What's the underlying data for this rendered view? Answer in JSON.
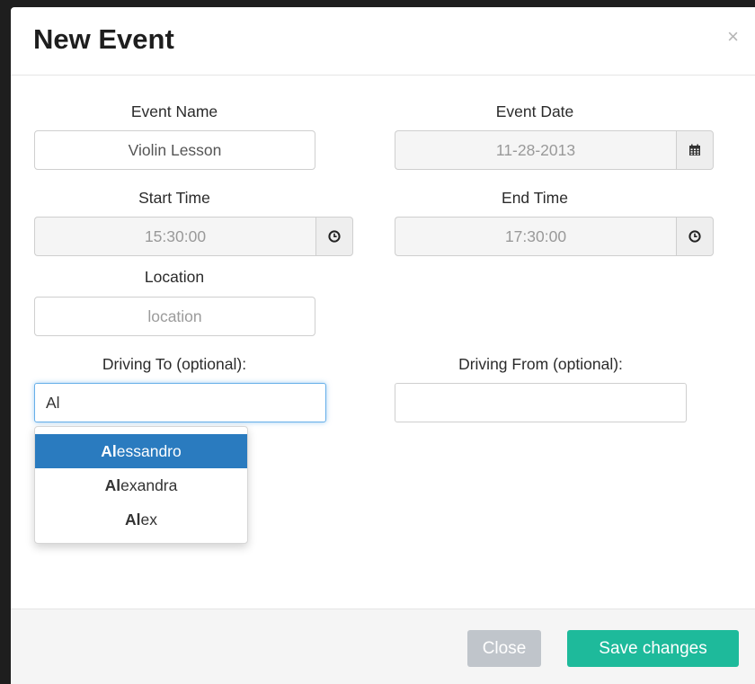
{
  "modal": {
    "title": "New Event",
    "close_symbol": "×"
  },
  "form": {
    "event_name": {
      "label": "Event Name",
      "value": "Violin Lesson"
    },
    "event_date": {
      "label": "Event Date",
      "value": "11-28-2013",
      "icon": "calendar-icon"
    },
    "start_time": {
      "label": "Start Time",
      "value": "15:30:00",
      "icon": "clock-icon"
    },
    "end_time": {
      "label": "End Time",
      "value": "17:30:00",
      "icon": "clock-icon"
    },
    "location": {
      "label": "Location",
      "placeholder": "location"
    },
    "driving_to": {
      "label": "Driving To (optional):",
      "value": "Al"
    },
    "driving_from": {
      "label": "Driving From (optional):",
      "value": ""
    }
  },
  "suggestions": [
    {
      "match": "Al",
      "rest": "essandro",
      "active": true
    },
    {
      "match": "Al",
      "rest": "exandra",
      "active": false
    },
    {
      "match": "Al",
      "rest": "ex",
      "active": false
    }
  ],
  "footer": {
    "close_label": "Close",
    "save_label": "Save changes"
  },
  "colors": {
    "primary_highlight": "#2a7bbf",
    "save_button": "#1eba9b",
    "close_button": "#c0c5cb",
    "focus_border": "#66afe9"
  }
}
